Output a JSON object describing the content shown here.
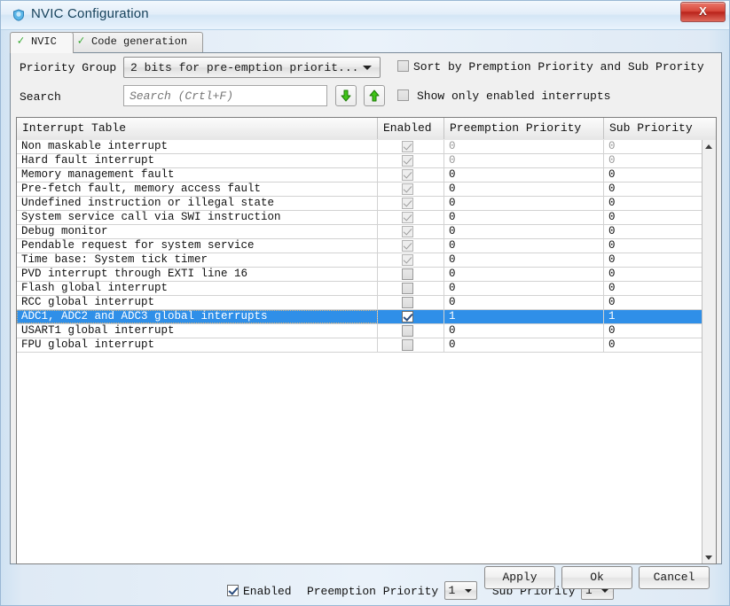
{
  "window": {
    "title": "NVIC Configuration",
    "icon": "shield-icon",
    "close_label": "X"
  },
  "tabs": [
    {
      "label": "NVIC",
      "icon": "green-check-icon",
      "active": true
    },
    {
      "label": "Code generation",
      "icon": "green-check-icon",
      "active": false
    }
  ],
  "toolbar": {
    "priority_group_label": "Priority Group",
    "priority_group_value": "2 bits for pre-emption priorit...",
    "search_label": "Search",
    "search_value": "",
    "search_placeholder": "Search (Crtl+F)",
    "search_next_icon": "arrow-down-green-icon",
    "search_prev_icon": "arrow-up-green-icon",
    "sort_checkbox_label": "Sort by Premption Priority and Sub Prority",
    "sort_checkbox_checked": false,
    "show_enabled_checkbox_label": "Show only enabled interrupts",
    "show_enabled_checkbox_checked": false
  },
  "table": {
    "columns": [
      "Interrupt Table",
      "Enabled",
      "Preemption Priority",
      "Sub Priority"
    ],
    "rows": [
      {
        "name": "Non maskable interrupt",
        "enabled": true,
        "locked": true,
        "preemption": "0",
        "sub": "0",
        "dim": true,
        "selected": false
      },
      {
        "name": "Hard fault interrupt",
        "enabled": true,
        "locked": true,
        "preemption": "0",
        "sub": "0",
        "dim": true,
        "selected": false
      },
      {
        "name": "Memory management fault",
        "enabled": true,
        "locked": true,
        "preemption": "0",
        "sub": "0",
        "dim": false,
        "selected": false
      },
      {
        "name": "Pre-fetch fault, memory access fault",
        "enabled": true,
        "locked": true,
        "preemption": "0",
        "sub": "0",
        "dim": false,
        "selected": false
      },
      {
        "name": "Undefined instruction or illegal state",
        "enabled": true,
        "locked": true,
        "preemption": "0",
        "sub": "0",
        "dim": false,
        "selected": false
      },
      {
        "name": "System service call via SWI instruction",
        "enabled": true,
        "locked": true,
        "preemption": "0",
        "sub": "0",
        "dim": false,
        "selected": false
      },
      {
        "name": "Debug monitor",
        "enabled": true,
        "locked": true,
        "preemption": "0",
        "sub": "0",
        "dim": false,
        "selected": false
      },
      {
        "name": "Pendable request for system service",
        "enabled": true,
        "locked": true,
        "preemption": "0",
        "sub": "0",
        "dim": false,
        "selected": false
      },
      {
        "name": "Time base: System tick timer",
        "enabled": true,
        "locked": true,
        "preemption": "0",
        "sub": "0",
        "dim": false,
        "selected": false
      },
      {
        "name": "PVD interrupt through EXTI line 16",
        "enabled": false,
        "locked": false,
        "preemption": "0",
        "sub": "0",
        "dim": false,
        "selected": false
      },
      {
        "name": "Flash global interrupt",
        "enabled": false,
        "locked": false,
        "preemption": "0",
        "sub": "0",
        "dim": false,
        "selected": false
      },
      {
        "name": "RCC global interrupt",
        "enabled": false,
        "locked": false,
        "preemption": "0",
        "sub": "0",
        "dim": false,
        "selected": false
      },
      {
        "name": "ADC1, ADC2 and ADC3 global interrupts",
        "enabled": true,
        "locked": false,
        "preemption": "1",
        "sub": "1",
        "dim": false,
        "selected": true
      },
      {
        "name": "USART1 global interrupt",
        "enabled": false,
        "locked": false,
        "preemption": "0",
        "sub": "0",
        "dim": false,
        "selected": false
      },
      {
        "name": "FPU global interrupt",
        "enabled": false,
        "locked": false,
        "preemption": "0",
        "sub": "0",
        "dim": false,
        "selected": false
      }
    ],
    "scrollbar": {
      "up_icon": "scroll-up-arrow-icon",
      "down_icon": "scroll-down-arrow-icon"
    }
  },
  "editor": {
    "enabled_label": "Enabled",
    "enabled_checked": true,
    "preemption_label": "Preemption Priority",
    "preemption_value": "1",
    "sub_label": "Sub Priority",
    "sub_value": "1"
  },
  "buttons": {
    "apply": "Apply",
    "ok": "Ok",
    "cancel": "Cancel"
  }
}
